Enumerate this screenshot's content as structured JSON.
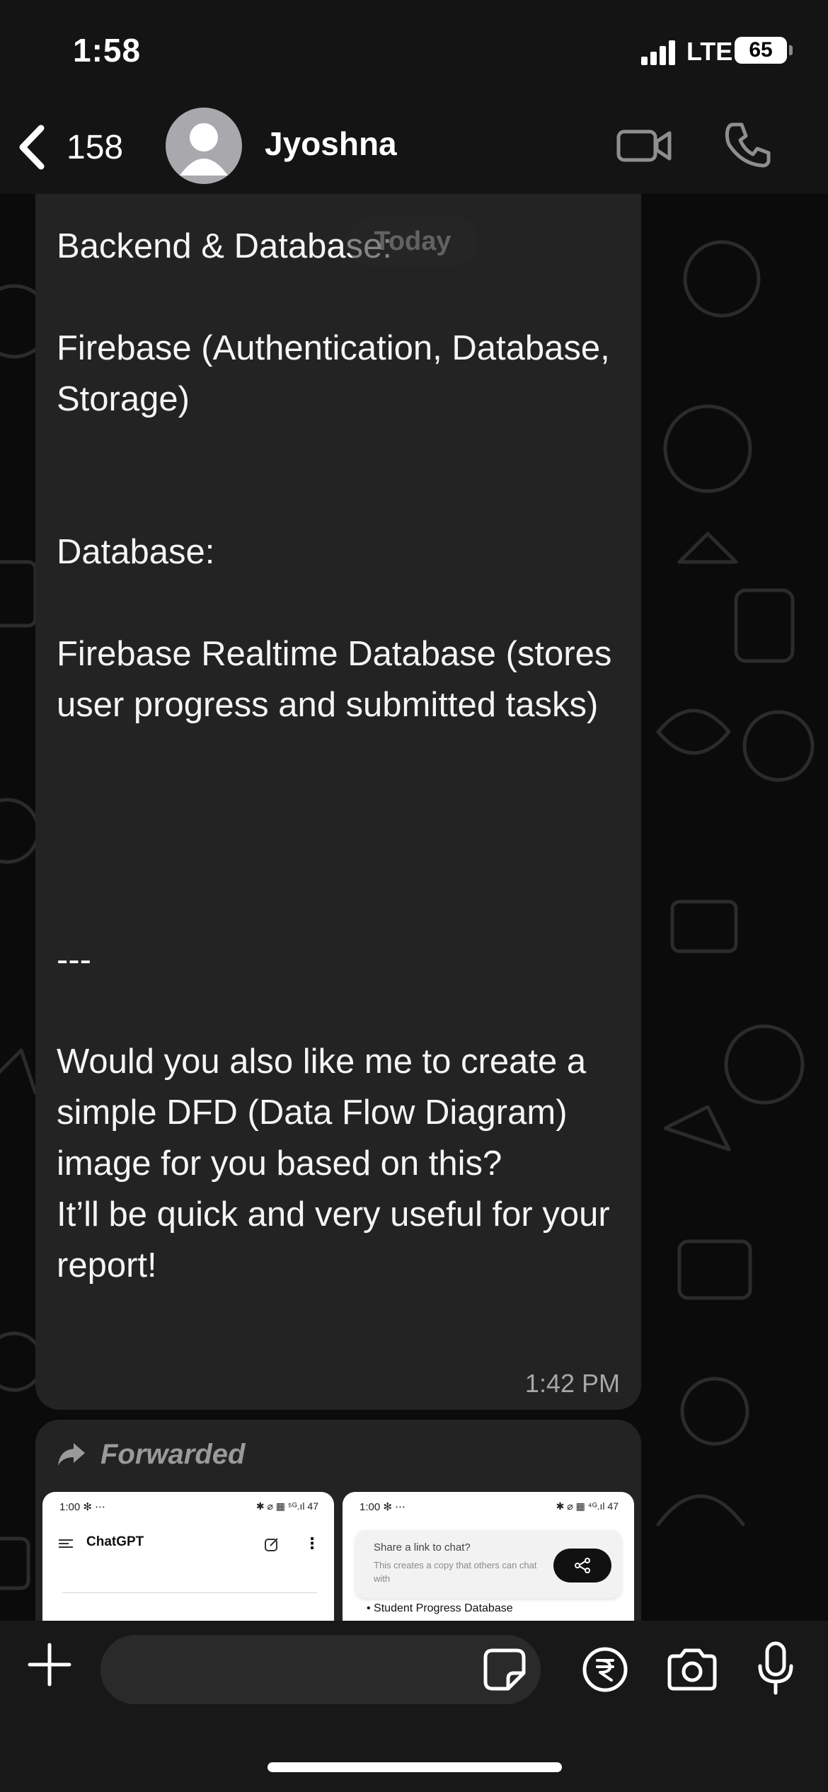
{
  "status_bar": {
    "time": "1:58",
    "network": "LTE",
    "battery": "65"
  },
  "header": {
    "back_count": "158",
    "contact_name": "Jyoshna",
    "icons": [
      "chevron-left-icon",
      "avatar-placeholder",
      "video-camera-icon",
      "phone-icon"
    ]
  },
  "date_pill": "Today",
  "message": {
    "text": "Backend & Database:\n\nFirebase (Authentication, Database, Storage)\n\n\nDatabase:\n\nFirebase Realtime Database (stores user progress and submitted tasks)\n\n\n\n\n---\n\nWould you also like me to create a simple DFD (Data Flow Diagram) image for you based on this?\nIt’ll be quick and very useful for your report!",
    "time": "1:42 PM"
  },
  "forwarded": {
    "label": "Forwarded",
    "thumb1": {
      "status_time": "1:00",
      "status_icons": "✻ ⋯",
      "status_right": "✱ ⌀ ▦ ⁵ᴳ.ıl 47",
      "title": "ChatGPT"
    },
    "thumb2": {
      "status_time": "1:00",
      "status_icons": "✻ ⋯",
      "status_right": "✱ ⌀ ▦ ⁴ᴳ.ıl 47",
      "share_title": "Share a link to chat?",
      "share_sub": "This creates a copy that others can chat with",
      "bullet": "• Student Progress Database"
    }
  },
  "composer": {
    "placeholder": "",
    "icons": [
      "plus-icon",
      "sticker-icon",
      "rupee-payment-icon",
      "camera-icon",
      "microphone-icon"
    ]
  },
  "colors": {
    "background": "#0b0b0b",
    "bubble": "#232323",
    "header": "#141414",
    "text": "#f5f5f5",
    "timestamp": "#a7a7a7"
  }
}
